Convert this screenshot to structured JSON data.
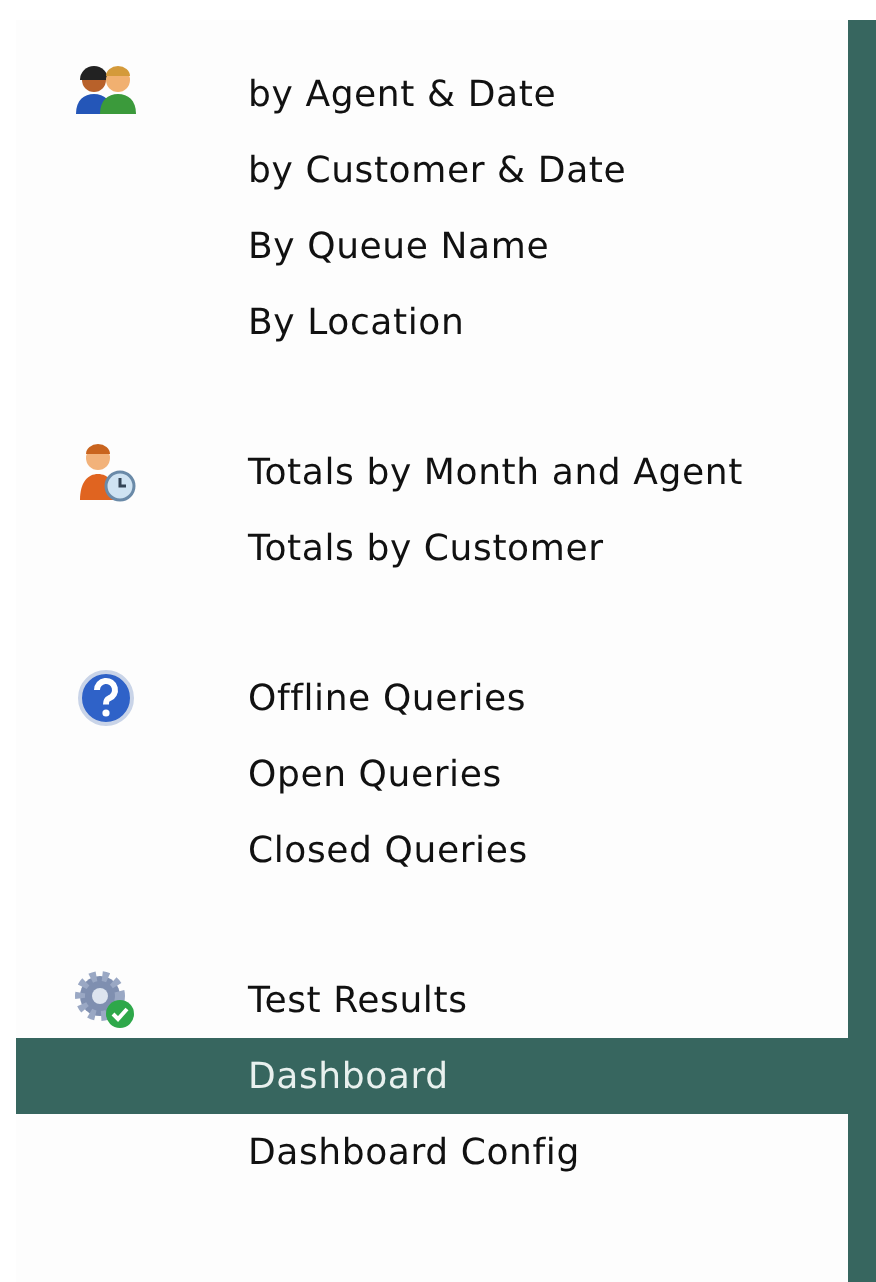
{
  "menu_groups": [
    {
      "kind": "people",
      "items": [
        {
          "label": "by Agent & Date",
          "selected": false
        },
        {
          "label": "by Customer & Date",
          "selected": false
        },
        {
          "label": "By Queue Name",
          "selected": false
        },
        {
          "label": "By Location",
          "selected": false
        }
      ]
    },
    {
      "kind": "person-clock",
      "items": [
        {
          "label": "Totals by Month and Agent",
          "selected": false
        },
        {
          "label": "Totals by Customer",
          "selected": false
        }
      ]
    },
    {
      "kind": "help",
      "items": [
        {
          "label": "Offline Queries",
          "selected": false
        },
        {
          "label": "Open Queries",
          "selected": false
        },
        {
          "label": "Closed Queries",
          "selected": false
        }
      ]
    },
    {
      "kind": "gear-check",
      "items": [
        {
          "label": "Test Results",
          "selected": false
        },
        {
          "label": "Dashboard",
          "selected": true
        },
        {
          "label": "Dashboard Config",
          "selected": false
        }
      ]
    }
  ]
}
